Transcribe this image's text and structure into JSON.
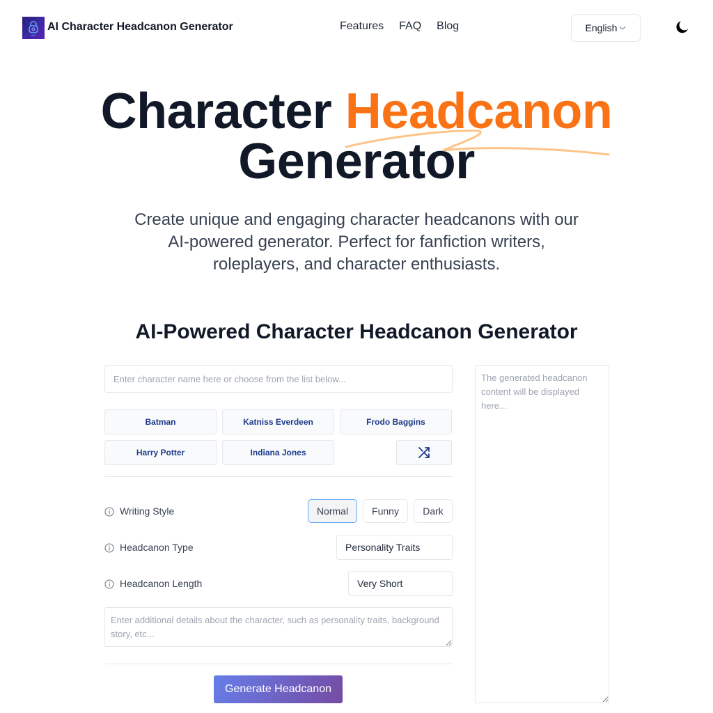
{
  "header": {
    "logo_icon": "robot-lock-icon",
    "brand": "AI Character Headcanon Generator",
    "nav": [
      {
        "label": "Features"
      },
      {
        "label": "FAQ"
      },
      {
        "label": "Blog"
      }
    ],
    "language": "English",
    "language_icon": "chevron-down-icon",
    "theme_icon": "moon-icon"
  },
  "hero": {
    "title_part1": "Character",
    "title_accent": "Headcanon",
    "title_part2": "Generator",
    "subtitle": "Create unique and engaging character headcanons with our AI-powered generator. Perfect for fanfiction writers, roleplayers, and character enthusiasts.",
    "accent_color": "#f97316"
  },
  "generator": {
    "section_title": "AI-Powered Character Headcanon Generator",
    "character_input": {
      "value": "",
      "placeholder": "Enter character name here or choose from the list below..."
    },
    "characters": [
      {
        "label": "Batman"
      },
      {
        "label": "Katniss Everdeen"
      },
      {
        "label": "Frodo Baggins"
      },
      {
        "label": "Harry Potter"
      },
      {
        "label": "Indiana Jones"
      }
    ],
    "shuffle_icon": "shuffle-icon",
    "writing_style": {
      "label": "Writing Style",
      "options": [
        {
          "label": "Normal",
          "selected": true
        },
        {
          "label": "Funny",
          "selected": false
        },
        {
          "label": "Dark",
          "selected": false
        }
      ]
    },
    "headcanon_type": {
      "label": "Headcanon Type",
      "value": "Personality Traits"
    },
    "headcanon_length": {
      "label": "Headcanon Length",
      "value": "Very Short"
    },
    "details": {
      "value": "",
      "placeholder": "Enter additional details about the character, such as personality traits, background story, etc..."
    },
    "generate_label": "Generate Headcanon",
    "output": {
      "value": "",
      "placeholder": "The generated headcanon content will be displayed here..."
    }
  }
}
